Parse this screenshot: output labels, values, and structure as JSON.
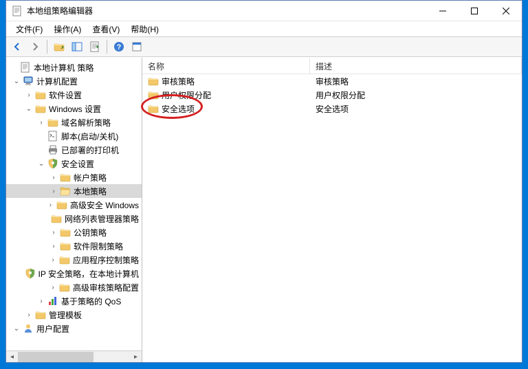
{
  "window": {
    "title": "本地组策略编辑器"
  },
  "menubar": [
    "文件(F)",
    "操作(A)",
    "查看(V)",
    "帮助(H)"
  ],
  "tree": {
    "root": "本地计算机 策略",
    "computer": "计算机配置",
    "software": "软件设置",
    "windows": "Windows 设置",
    "dns": "域名解析策略",
    "scripts": "脚本(启动/关机)",
    "printers": "已部署的打印机",
    "security": "安全设置",
    "account": "帐户策略",
    "local": "本地策略",
    "advfw": "高级安全 Windows",
    "netlist": "网络列表管理器策略",
    "pubkey": "公钥策略",
    "softrestrict": "软件限制策略",
    "appctrl": "应用程序控制策略",
    "ipsec": "IP 安全策略，在本地计算机",
    "advaudit": "高级审核策略配置",
    "qos": "基于策略的 QoS",
    "admintpl": "管理模板",
    "user": "用户配置"
  },
  "list": {
    "headers": {
      "name": "名称",
      "desc": "描述"
    },
    "rows": [
      {
        "name": "审核策略",
        "desc": "审核策略"
      },
      {
        "name": "用户权限分配",
        "desc": "用户权限分配"
      },
      {
        "name": "安全选项",
        "desc": "安全选项"
      }
    ]
  }
}
